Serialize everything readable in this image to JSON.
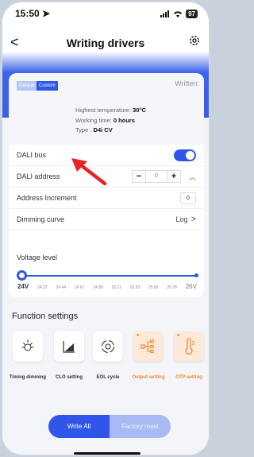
{
  "status": {
    "time": "15:50",
    "battery": "97"
  },
  "nav": {
    "title": "Writing drivers"
  },
  "info": {
    "segment_default": "Default",
    "segment_custom": "Custom",
    "status": "Written:",
    "temp_label": "Highest temperature:",
    "temp_value": "30°C",
    "time_label": "Working time:",
    "time_value": "0 hours",
    "type_label": "Type :",
    "type_value": "D4i CV"
  },
  "settings": {
    "dali_bus": {
      "label": "DALI bus",
      "enabled": true
    },
    "dali_address": {
      "label": "DALI address",
      "minus": "−",
      "value": "0",
      "plus": "+"
    },
    "address_increment": {
      "label": "Address Increment",
      "value": "0"
    },
    "dimming_curve": {
      "label": "Dimming curve",
      "value": "Log"
    },
    "voltage": {
      "label": "Voltage level",
      "min_label": "24V",
      "ticks": [
        "24.22",
        "24.44",
        "24.67",
        "24.89",
        "25.11",
        "25.33",
        "25.56",
        "25.78"
      ],
      "max_label": "26V",
      "level": 0
    }
  },
  "functions": {
    "title": "Function settings",
    "items": [
      {
        "label": "Timing dimming",
        "icon": "sun-icon",
        "active": false
      },
      {
        "label": "CLO setting",
        "icon": "bar-chart-icon",
        "active": false
      },
      {
        "label": "EOL cycle",
        "icon": "cycle-icon",
        "active": false
      },
      {
        "label": "Output setting",
        "icon": "output-tree-icon",
        "active": true
      },
      {
        "label": "OTP setting",
        "icon": "thermometer-icon",
        "active": true
      }
    ]
  },
  "actions": {
    "write_all": "Write All",
    "factory_reset": "Factory reset"
  },
  "colors": {
    "accent": "#2f56e8",
    "orange": "#f08a34",
    "header": "#3a5ee6"
  }
}
